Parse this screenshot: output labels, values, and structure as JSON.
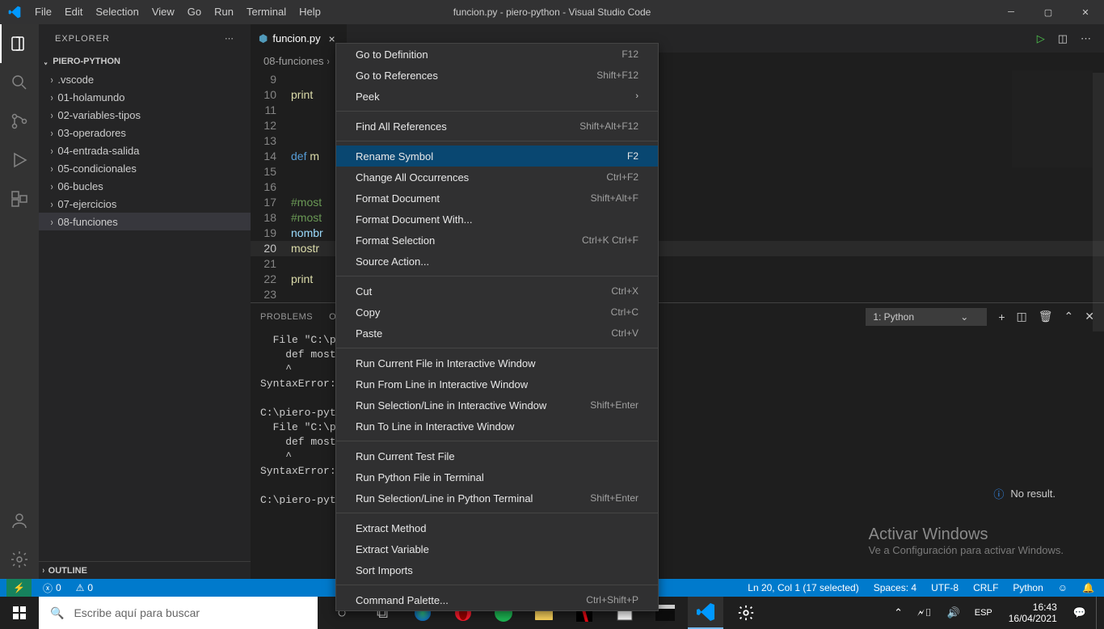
{
  "window": {
    "title": "funcion.py - piero-python - Visual Studio Code",
    "menu": [
      "File",
      "Edit",
      "Selection",
      "View",
      "Go",
      "Run",
      "Terminal",
      "Help"
    ]
  },
  "sidebar": {
    "title": "EXPLORER",
    "project": "PIERO-PYTHON",
    "items": [
      ".vscode",
      "01-holamundo",
      "02-variables-tipos",
      "03-operadores",
      "04-entrada-salida",
      "05-condicionales",
      "06-bucles",
      "07-ejercicios",
      "08-funciones"
    ],
    "outline": "OUTLINE"
  },
  "tab": {
    "name": "funcion.py"
  },
  "breadcrumb": [
    "08-funciones"
  ],
  "code_lines": [
    {
      "n": 9,
      "txt": ""
    },
    {
      "n": 10,
      "txt": "print"
    },
    {
      "n": 11,
      "txt": ""
    },
    {
      "n": 12,
      "txt": ""
    },
    {
      "n": 13,
      "txt": ""
    },
    {
      "n": 14,
      "txt": "def m"
    },
    {
      "n": 15,
      "txt": "    "
    },
    {
      "n": 16,
      "txt": ""
    },
    {
      "n": 17,
      "txt": "#most"
    },
    {
      "n": 18,
      "txt": "#most"
    },
    {
      "n": 19,
      "txt": "nombr"
    },
    {
      "n": 20,
      "txt": "mostr"
    },
    {
      "n": 21,
      "txt": ""
    },
    {
      "n": 22,
      "txt": "print"
    },
    {
      "n": 23,
      "txt": ""
    }
  ],
  "context_menu": [
    [
      {
        "label": "Go to Definition",
        "short": "F12"
      },
      {
        "label": "Go to References",
        "short": "Shift+F12"
      },
      {
        "label": "Peek",
        "submenu": true
      }
    ],
    [
      {
        "label": "Find All References",
        "short": "Shift+Alt+F12"
      }
    ],
    [
      {
        "label": "Rename Symbol",
        "short": "F2",
        "selected": true
      },
      {
        "label": "Change All Occurrences",
        "short": "Ctrl+F2"
      },
      {
        "label": "Format Document",
        "short": "Shift+Alt+F"
      },
      {
        "label": "Format Document With..."
      },
      {
        "label": "Format Selection",
        "short": "Ctrl+K Ctrl+F"
      },
      {
        "label": "Source Action..."
      }
    ],
    [
      {
        "label": "Cut",
        "short": "Ctrl+X"
      },
      {
        "label": "Copy",
        "short": "Ctrl+C"
      },
      {
        "label": "Paste",
        "short": "Ctrl+V"
      }
    ],
    [
      {
        "label": "Run Current File in Interactive Window"
      },
      {
        "label": "Run From Line in Interactive Window"
      },
      {
        "label": "Run Selection/Line in Interactive Window",
        "short": "Shift+Enter"
      },
      {
        "label": "Run To Line in Interactive Window"
      }
    ],
    [
      {
        "label": "Run Current Test File"
      },
      {
        "label": "Run Python File in Terminal"
      },
      {
        "label": "Run Selection/Line in Python Terminal",
        "short": "Shift+Enter"
      }
    ],
    [
      {
        "label": "Extract Method"
      },
      {
        "label": "Extract Variable"
      },
      {
        "label": "Sort Imports"
      }
    ],
    [
      {
        "label": "Command Palette...",
        "short": "Ctrl+Shift+P"
      }
    ]
  ],
  "panel": {
    "tabs": [
      "PROBLEMS",
      "OU"
    ],
    "terminal_selector": "1: Python",
    "body": "  File \"C:\\pi\n    def mostr\n    ^\nSyntaxError: \n\nC:\\piero-pyth\n  File \"C:\\pi\n    def mostr\n    ^\nSyntaxError: \n\nC:\\piero-pyth",
    "no_result": "No result."
  },
  "statusbar": {
    "left_errors": "0",
    "left_warnings": "0",
    "right": {
      "lncol": "Ln 20, Col 1 (17 selected)",
      "spaces": "Spaces: 4",
      "encoding": "UTF-8",
      "eol": "CRLF",
      "lang": "Python",
      "feedback": "☺"
    }
  },
  "activate": {
    "title": "Activar Windows",
    "sub": "Ve a Configuración para activar Windows."
  },
  "taskbar": {
    "search": "Escribe aquí para buscar",
    "clock": {
      "time": "16:43",
      "date": "16/04/2021"
    }
  }
}
